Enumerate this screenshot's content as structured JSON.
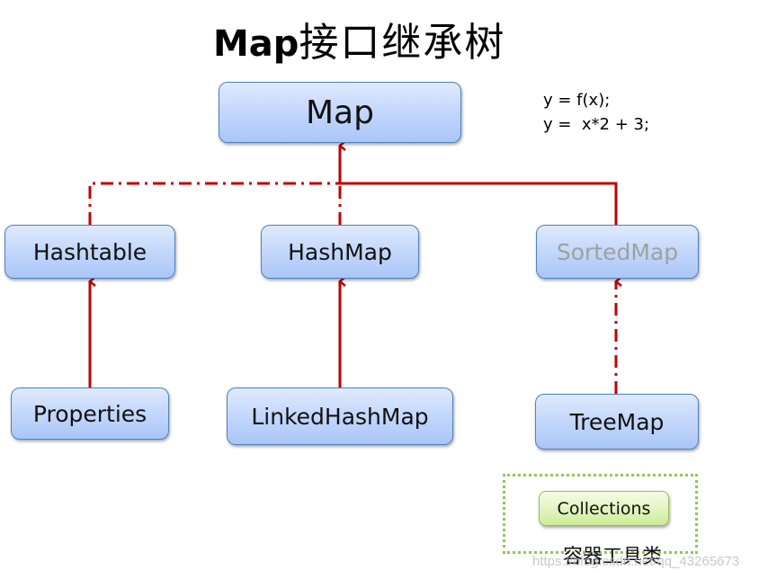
{
  "title": {
    "en": "Map",
    "cn": "接口继承树"
  },
  "formula": {
    "line1": "y = f(x);",
    "line2": "y =  x*2 + 3;"
  },
  "nodes": {
    "map": "Map",
    "hashtable": "Hashtable",
    "hashmap": "HashMap",
    "sortedmap": "SortedMap",
    "properties": "Properties",
    "linkedhashmap": "LinkedHashMap",
    "treemap": "TreeMap"
  },
  "relations": [
    {
      "from": "HashMap",
      "to": "Map",
      "style": "solid",
      "kind": "inheritance"
    },
    {
      "from": "SortedMap",
      "to": "Map",
      "style": "solid",
      "kind": "inheritance"
    },
    {
      "from": "Hashtable",
      "to": "Map",
      "style": "dash-dot",
      "kind": "implementation"
    },
    {
      "from": "HashMap",
      "to": "Map",
      "style": "dash-dot",
      "kind": "implementation"
    },
    {
      "from": "Properties",
      "to": "Hashtable",
      "style": "solid",
      "kind": "inheritance"
    },
    {
      "from": "LinkedHashMap",
      "to": "HashMap",
      "style": "solid",
      "kind": "inheritance"
    },
    {
      "from": "TreeMap",
      "to": "SortedMap",
      "style": "dash-dot",
      "kind": "implementation"
    }
  ],
  "utility": {
    "label": "Collections",
    "caption": "容器工具类"
  },
  "watermark": "https://blog.csdn.net/qq_43265673",
  "colors": {
    "line": "#c00000",
    "node_border": "#4f81bd",
    "util_border": "#8fca4e",
    "faded_text": "#a0a0a0"
  }
}
